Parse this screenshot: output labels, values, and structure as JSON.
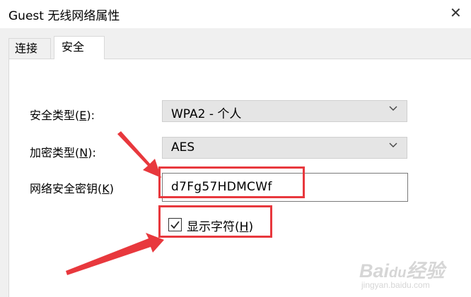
{
  "window": {
    "title": "Guest 无线网络属性",
    "close_glyph": "✕"
  },
  "tabs": [
    {
      "label": "连接",
      "active": false
    },
    {
      "label": "安全",
      "active": true
    }
  ],
  "security": {
    "type_label": "安全类型(",
    "type_key": "E",
    "type_label_end": "):",
    "type_value": "WPA2 - 个人",
    "encryption_label": "加密类型(",
    "encryption_key": "N",
    "encryption_label_end": "):",
    "encryption_value": "AES",
    "key_label": "网络安全密钥(",
    "key_key": "K",
    "key_label_end": ")",
    "key_value": "d7Fg57HDMCWf",
    "show_chars_label": "显示字符(",
    "show_chars_key": "H",
    "show_chars_label_end": ")",
    "show_chars_checked": true
  },
  "annotations": {
    "highlight_color": "#e8383d"
  },
  "watermark": {
    "brand": "Bai",
    "brand_end": "经验",
    "url": "jingyan.baidu.com"
  }
}
